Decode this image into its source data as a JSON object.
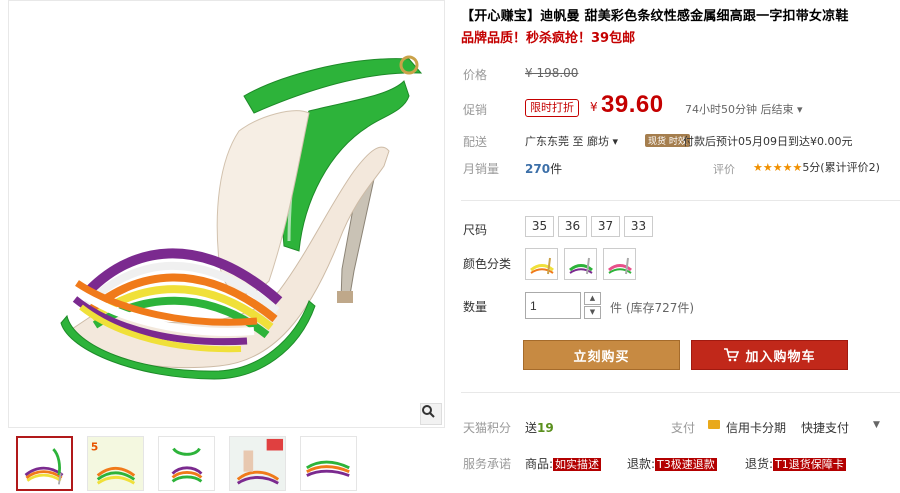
{
  "product": {
    "title": "【开心赚宝】迪帆曼 甜美彩色条纹性感金属细高跟一字扣带女凉鞋",
    "subtitle": "品牌品质！秒杀疯抢！39包邮"
  },
  "price": {
    "label": "价格",
    "original": "¥ 198.00"
  },
  "promo": {
    "label": "促销",
    "tag": "限时打折",
    "yen": "¥",
    "price": "39.60",
    "countdown": "74小时50分钟 后结束 ▾"
  },
  "shipping": {
    "label": "配送",
    "from": "广东东莞  至   廊坊  ▾",
    "tag": "现货 时效",
    "text": "付款后预计05月09日到达¥0.00元"
  },
  "sales": {
    "label": "月销量",
    "count": "270",
    "unit": "件",
    "rating_label": "评价",
    "stars": "★★★★★",
    "rating_text": "5分(累计评价2)"
  },
  "size": {
    "label": "尺码",
    "options": [
      "35",
      "36",
      "37",
      "33"
    ]
  },
  "color": {
    "label": "颜色分类"
  },
  "quantity": {
    "label": "数量",
    "value": "1",
    "stock": "件 (库存727件)"
  },
  "actions": {
    "buy_label": "立刻购买",
    "cart_label": "加入购物车"
  },
  "tmall": {
    "label": "天猫积分",
    "points_prefix": "送",
    "points": "19",
    "pay_label": "支付",
    "credit_label": "信用卡分期",
    "quick_pay": "快捷支付"
  },
  "service": {
    "label": "服务承诺",
    "goods_label": "商品:",
    "goods_tag": "如实描述",
    "refund_label": "退款:",
    "refund_tag": "T3极速退款",
    "return_label": "退货:",
    "return_tag": "T1退货保障卡"
  },
  "colors": {
    "accent_red": "#c40000",
    "buy_button": "#c78a42",
    "cart_button": "#c1281a",
    "shoe_green": "#2db33a"
  }
}
